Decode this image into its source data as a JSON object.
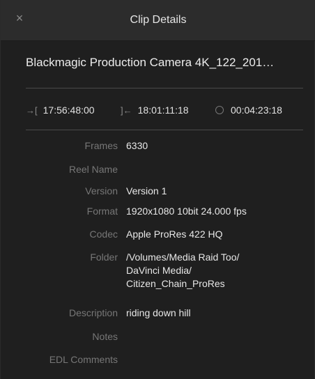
{
  "window": {
    "title": "Clip Details",
    "close_icon": "×"
  },
  "clip": {
    "name": "Blackmagic Production Camera 4K_122_201…"
  },
  "timecode": {
    "in_icon": "→[",
    "in": "17:56:48:00",
    "out_icon": "]←",
    "out": "18:01:11:18",
    "duration": "00:04:23:18"
  },
  "metadata": [
    {
      "label": "Frames",
      "value": "6330"
    },
    {
      "label": "Reel Name",
      "value": ""
    },
    {
      "label": "Version",
      "value": "Version 1"
    },
    {
      "label": "Format",
      "value": "1920x1080 10bit 24.000 fps"
    },
    {
      "label": "Codec",
      "value": "Apple ProRes 422 HQ"
    },
    {
      "label": "Folder",
      "value": "/Volumes/Media Raid Too/\nDaVinci Media/\nCitizen_Chain_ProRes"
    },
    {
      "label": "Description",
      "value": "riding down hill"
    },
    {
      "label": "Notes",
      "value": ""
    },
    {
      "label": "EDL Comments",
      "value": ""
    }
  ]
}
